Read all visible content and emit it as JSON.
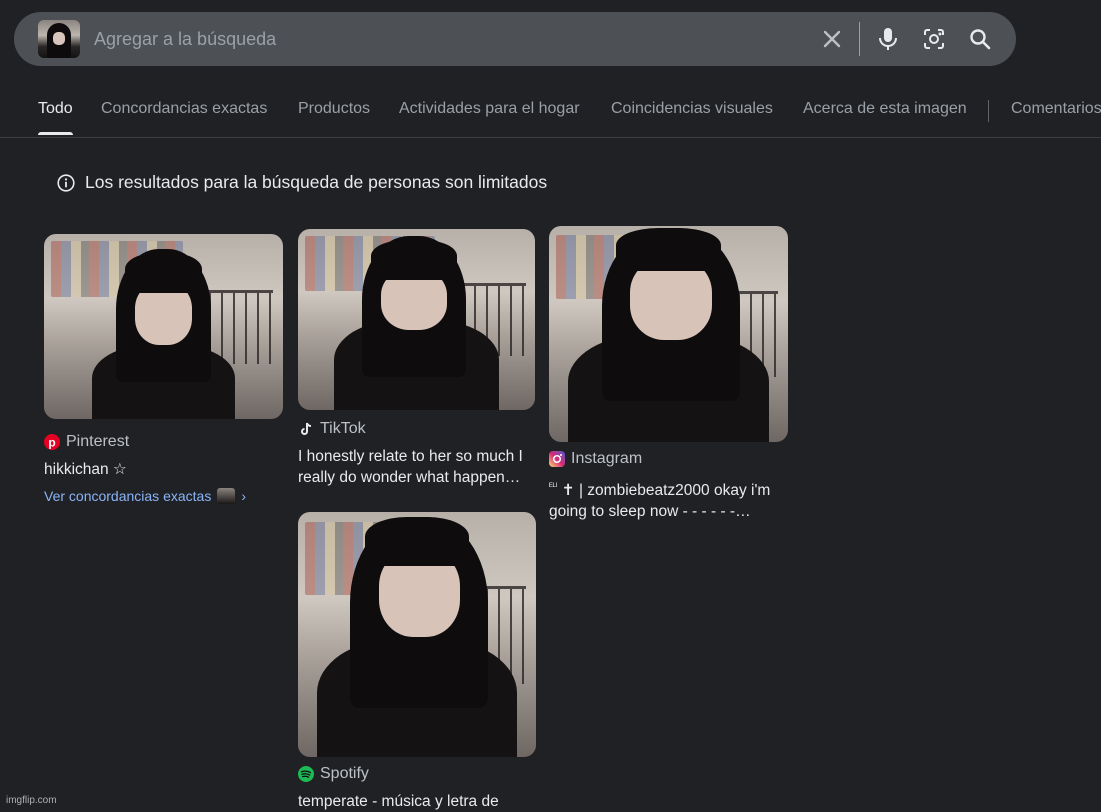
{
  "search": {
    "placeholder": "Agregar a la búsqueda",
    "icons": [
      "image-thumbnail",
      "close-icon",
      "mic-icon",
      "lens-icon",
      "search-icon"
    ]
  },
  "tabs": [
    {
      "label": "Todo",
      "active": true
    },
    {
      "label": "Concordancias exactas"
    },
    {
      "label": "Productos"
    },
    {
      "label": "Actividades para el hogar"
    },
    {
      "label": "Coincidencias visuales"
    },
    {
      "label": "Acerca de esta imagen"
    },
    {
      "label": "Comentarios"
    }
  ],
  "notice": {
    "text": "Los resultados para la búsqueda de personas son limitados",
    "icon": "info-icon"
  },
  "results": [
    {
      "source": "Pinterest",
      "title": "hikkichan ☆",
      "link": "Ver concordancias exactas",
      "source_icon": "pinterest-icon"
    },
    {
      "source": "TikTok",
      "title_line1": "I honestly relate to her so much I",
      "title_line2": "really do wonder what happen…",
      "source_icon": "tiktok-icon"
    },
    {
      "source": "Instagram",
      "prefix": "ᴱᴸᴵ",
      "title_line1": "✝ | zombiebeatz2000 okay i'm",
      "title_line2": "going to sleep now - - - - - -…",
      "source_icon": "instagram-icon"
    },
    {
      "source": "Spotify",
      "title": "temperate - música y letra de",
      "source_icon": "spotify-icon"
    }
  ],
  "watermark": "imgflip.com",
  "colors": {
    "background": "#202124",
    "searchbar": "#4d5156",
    "link": "#8ab4f8",
    "text": "#e8eaed",
    "muted": "#9aa0a6"
  }
}
